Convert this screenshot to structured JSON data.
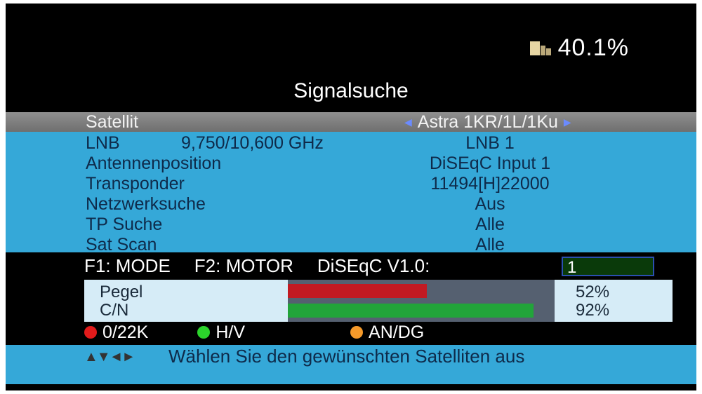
{
  "status": {
    "storage_icon": "storage-level-icon",
    "percent": "40.1%"
  },
  "title": "Signalsuche",
  "satellite": {
    "label": "Satellit",
    "value": "Astra 1KR/1L/1Ku"
  },
  "params": [
    {
      "label": "LNB",
      "mid": "9,750/10,600 GHz",
      "value": "LNB 1"
    },
    {
      "label": "Antennenposition",
      "mid": "",
      "value": "DiSEqC Input 1"
    },
    {
      "label": "Transponder",
      "mid": "",
      "value": "11494[H]22000"
    },
    {
      "label": "Netzwerksuche",
      "mid": "",
      "value": "Aus"
    },
    {
      "label": "TP Suche",
      "mid": "",
      "value": "Alle"
    },
    {
      "label": "Sat Scan",
      "mid": "",
      "value": "Alle"
    }
  ],
  "function_keys": {
    "f1": "F1: MODE",
    "f2": "F2: MOTOR",
    "diseqc_label": "DiSEqC V1.0:",
    "diseqc_value": "1"
  },
  "meters": [
    {
      "label": "Pegel",
      "value": "52%",
      "level": 0.52,
      "color": "#c21a22"
    },
    {
      "label": "C/N",
      "value": "92%",
      "level": 0.92,
      "color": "#22a43a"
    }
  ],
  "legend": [
    {
      "color": "#e21b1b",
      "label": "0/22K"
    },
    {
      "color": "#2bd42b",
      "label": "H/V"
    },
    {
      "color": "#f59a2a",
      "label": "AN/DG"
    }
  ],
  "help": {
    "arrows_icon": "navigation-arrows-icon",
    "arrows": "▲▼◄►",
    "text": "Wählen Sie den gewünschten Satelliten aus"
  },
  "colors": {
    "panel_blue": "#35a8d8",
    "highlight_gray": "#7f7f7f",
    "meter_bg": "#d6ecf7"
  }
}
